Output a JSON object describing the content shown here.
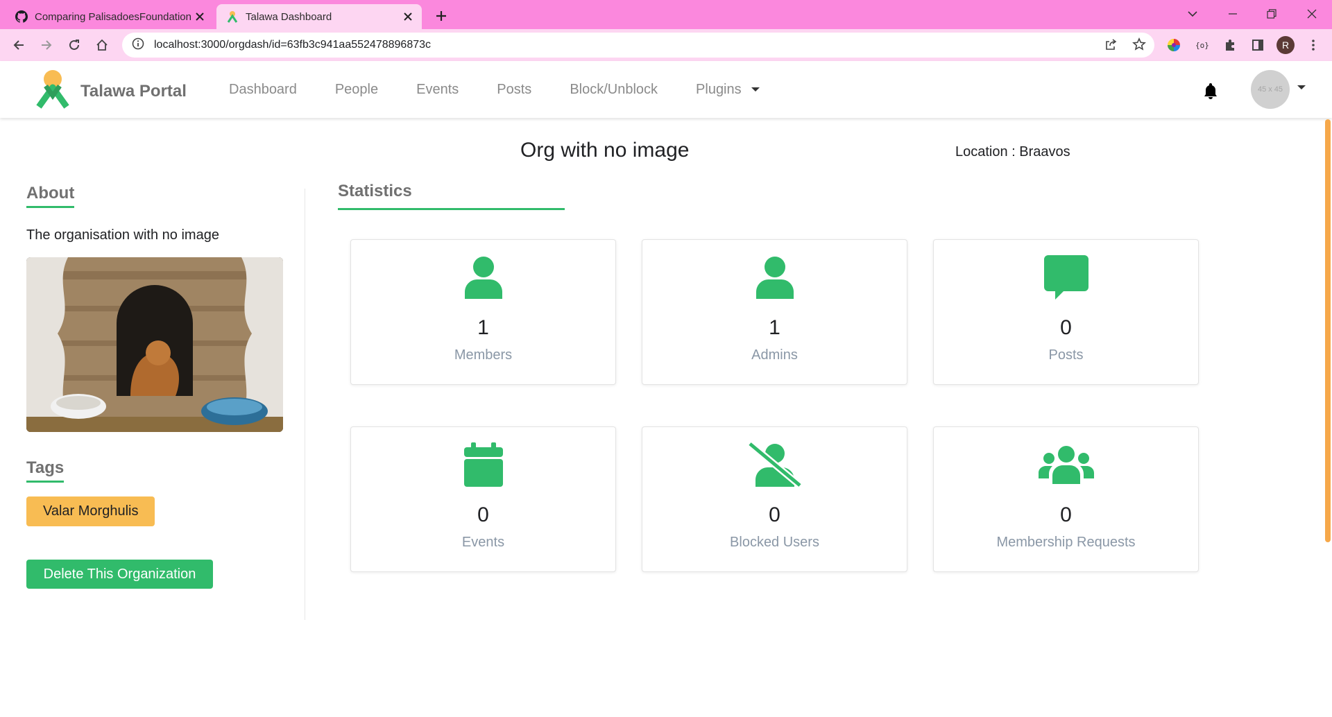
{
  "browser": {
    "tabs": [
      {
        "title": "Comparing PalisadoesFoundation",
        "favicon": "github-icon",
        "active": false
      },
      {
        "title": "Talawa Dashboard",
        "favicon": "talawa-icon",
        "active": true
      }
    ],
    "url": "localhost:3000/orgdash/id=63fb3c941aa552478896873c",
    "profile_initial": "R",
    "colors": {
      "tabstrip": "#fb88dd",
      "toolbar": "#fdd6f2"
    }
  },
  "navbar": {
    "brand": "Talawa Portal",
    "links": [
      "Dashboard",
      "People",
      "Events",
      "Posts",
      "Block/Unblock"
    ],
    "plugins_label": "Plugins",
    "avatar_placeholder": "45 x 45"
  },
  "org": {
    "name": "Org with no image",
    "location": "Location : Braavos"
  },
  "sidebar": {
    "about_heading": "About",
    "description": "The organisation with no image",
    "tags_heading": "Tags",
    "tags": [
      "Valar Morghulis"
    ],
    "delete_label": "Delete This Organization"
  },
  "statistics": {
    "heading": "Statistics",
    "cards": [
      {
        "value": "1",
        "label": "Members",
        "icon": "user-icon"
      },
      {
        "value": "1",
        "label": "Admins",
        "icon": "user-icon"
      },
      {
        "value": "0",
        "label": "Posts",
        "icon": "comment-icon"
      },
      {
        "value": "0",
        "label": "Events",
        "icon": "calendar-icon"
      },
      {
        "value": "0",
        "label": "Blocked Users",
        "icon": "user-slash-icon"
      },
      {
        "value": "0",
        "label": "Membership Requests",
        "icon": "users-icon"
      }
    ]
  },
  "colors": {
    "accent": "#31bb6b",
    "tag": "#f8bc53",
    "scroll_thumb": "#f6a84a"
  }
}
